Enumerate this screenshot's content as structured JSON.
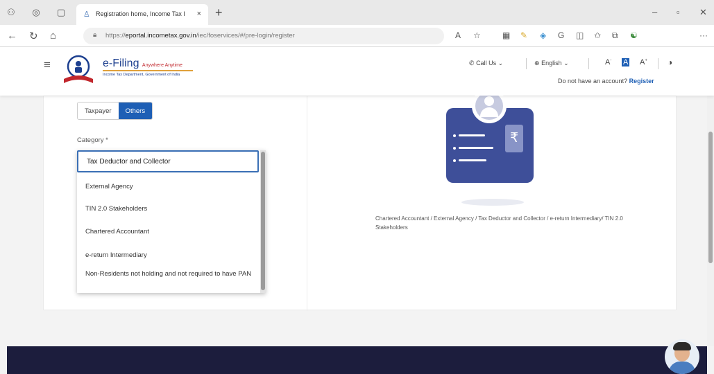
{
  "browser": {
    "tab_title": "Registration home, Income Tax I",
    "tab_close": "×",
    "new_tab": "+",
    "url_prefix": "https://",
    "url_host": "eportal.incometax.gov.in",
    "url_path": "/iec/foservices/#/pre-login/register"
  },
  "header": {
    "logo_title": "e-Filing",
    "logo_tagline": "Anywhere Anytime",
    "logo_subtitle": "Income Tax Department, Government of India",
    "call_us": "Call Us",
    "language": "English",
    "font_decrease": "A",
    "font_normal": "A",
    "font_increase": "A",
    "no_account_text": "Do not have an account?",
    "register_link": "Register"
  },
  "form": {
    "toggle_taxpayer": "Taxpayer",
    "toggle_others": "Others",
    "category_label": "Category *",
    "category_selected": "Tax Deductor and Collector",
    "options": [
      "External Agency",
      "TIN 2.0 Stakeholders",
      "Chartered Accountant",
      "e-return Intermediary",
      "Non-Residents not holding and not required to have PAN"
    ]
  },
  "illustration": {
    "description": "Chartered Accountant / External Agency / Tax Deductor and Collector / e-return Intermediary/ TIN 2.0 Stakeholders",
    "rupee_symbol": "₹"
  },
  "colors": {
    "primary": "#1e5fb5",
    "card_blue": "#3e4f99",
    "footer": "#1c1d3d"
  }
}
